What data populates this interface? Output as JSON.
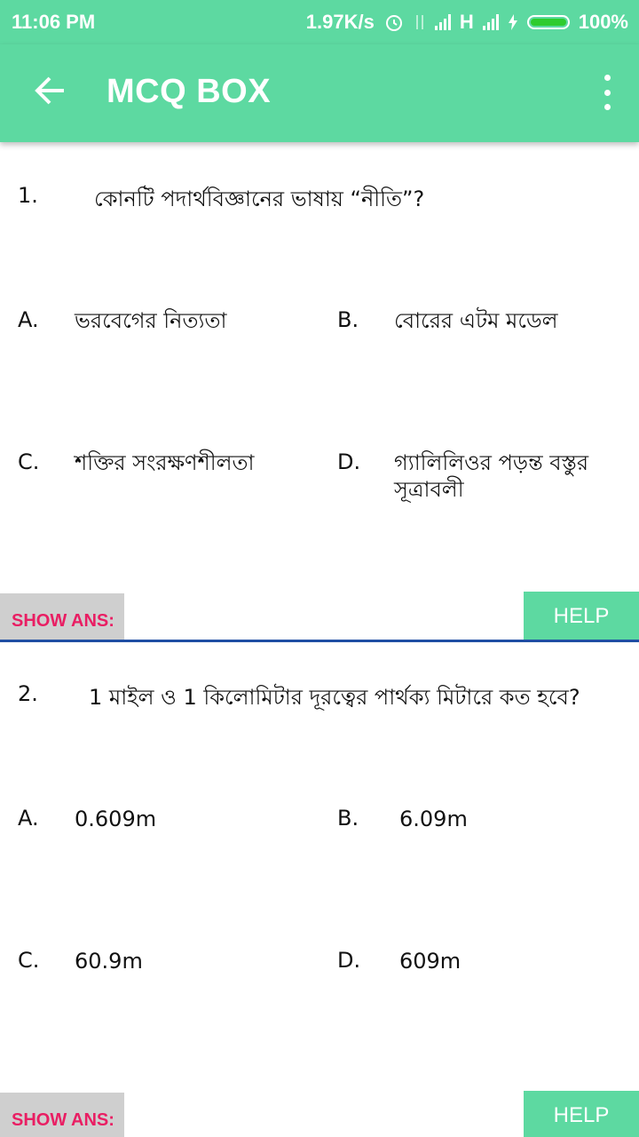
{
  "status": {
    "time": "11:06 PM",
    "speed": "1.97K/s",
    "network": "H",
    "battery": "100%"
  },
  "appbar": {
    "title": "MCQ BOX"
  },
  "questions": [
    {
      "number": "1.",
      "text": "কোনটি পদার্থবিজ্ঞানের ভাষায় “নীতি”?",
      "options": [
        {
          "label": "A.",
          "text": "ভরবেগের নিত্যতা"
        },
        {
          "label": "B.",
          "text": "বোরের এটম মডেল"
        },
        {
          "label": "C.",
          "text": "শক্তির সংরক্ষণশীলতা"
        },
        {
          "label": "D.",
          "text": "গ্যালিলিওর পড়ন্ত বস্তুর সূত্রাবলী"
        }
      ],
      "show_ans_label": "SHOW ANS:",
      "help_label": "HELP"
    },
    {
      "number": "2.",
      "text": "1 মাইল ও 1 কিলোমিটার দূরত্বের পার্থক্য মিটারে কত হবে?",
      "options": [
        {
          "label": "A.",
          "text": "0.609m"
        },
        {
          "label": "B.",
          "text": "6.09m"
        },
        {
          "label": "C.",
          "text": "60.9m"
        },
        {
          "label": "D.",
          "text": "609m"
        }
      ],
      "show_ans_label": "SHOW ANS:",
      "help_label": "HELP"
    }
  ],
  "colors": {
    "primary": "#5dd9a1",
    "accent": "#e91e63",
    "divider": "#1f4ea3"
  }
}
